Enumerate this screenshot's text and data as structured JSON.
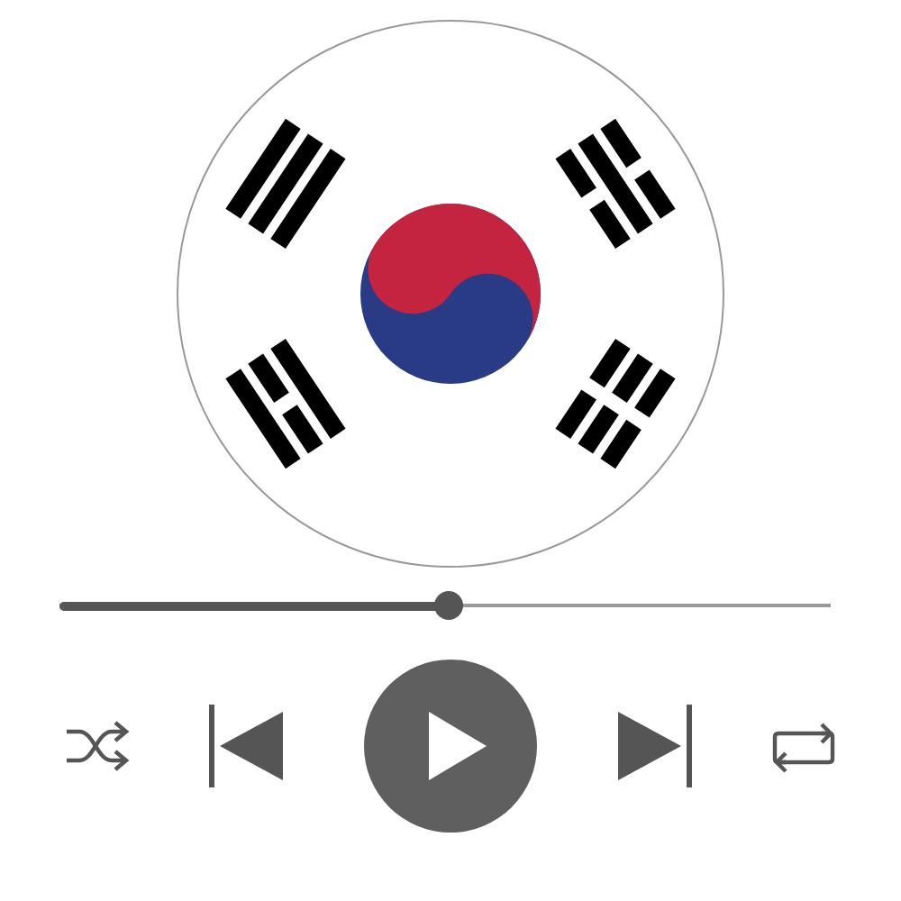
{
  "progress": {
    "level": 0.505
  },
  "controls": [
    {
      "kind": "shuffle"
    },
    {
      "kind": "previous"
    },
    {
      "kind": "play"
    },
    {
      "kind": "next"
    },
    {
      "kind": "repeat"
    }
  ]
}
